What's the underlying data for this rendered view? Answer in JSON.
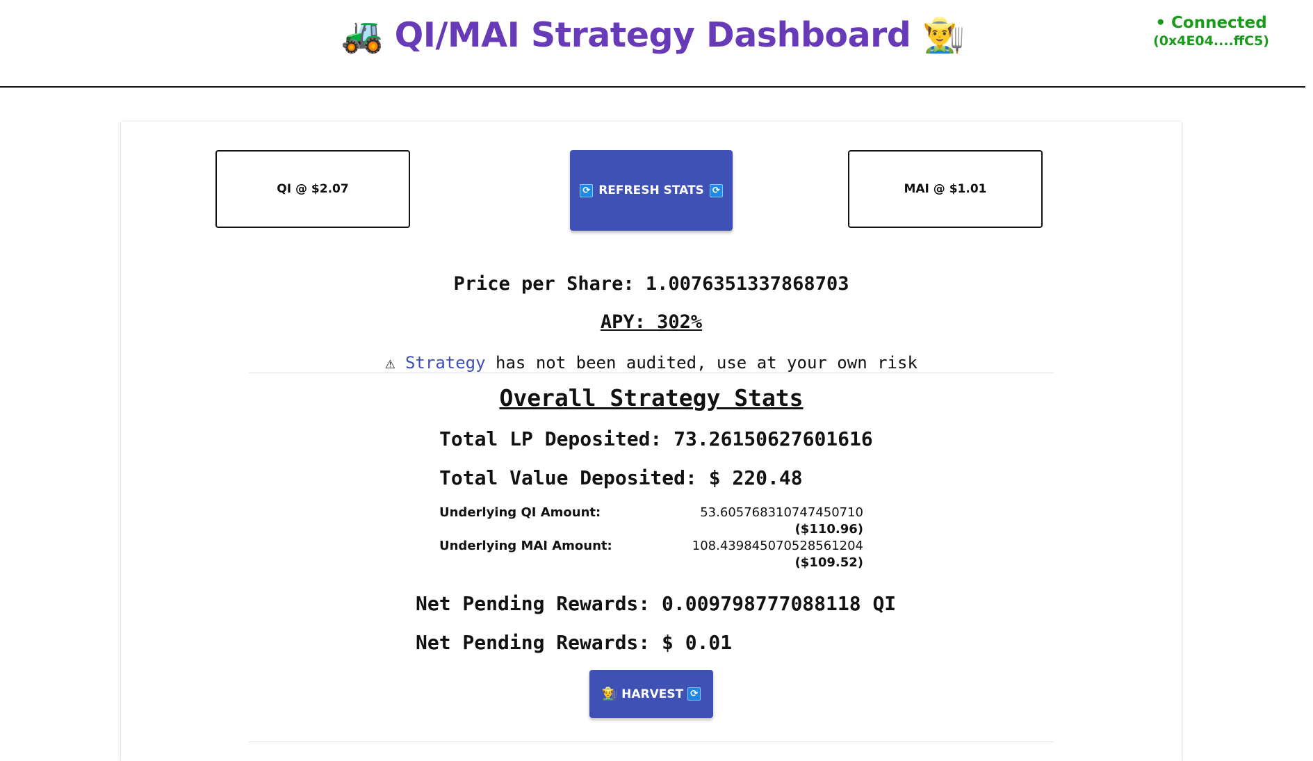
{
  "header": {
    "title": "QI/MAI Strategy Dashboard",
    "icon_left": "🚜",
    "icon_right": "👨‍🌾",
    "connection_status": "• Connected",
    "wallet_address": "(0x4E04....ffC5)"
  },
  "prices": {
    "qi_label": "QI @ $2.07",
    "mai_label": "MAI @ $1.01"
  },
  "refresh_button": {
    "label": "REFRESH STATS",
    "icon": "sync-icon"
  },
  "price_per_share": "Price per Share: 1.0076351337868703",
  "apy": "APY: 302%",
  "warning": {
    "icon": "⚠",
    "link_text": "Strategy",
    "text": " has not been audited, use at your own risk"
  },
  "overall": {
    "heading": "Overall Strategy Stats",
    "total_lp": "Total LP Deposited: 73.26150627601616",
    "total_value": "Total Value Deposited: $ 220.48",
    "qi": {
      "label": "Underlying QI Amount:",
      "amount": "53.605768310747450710",
      "usd": "($110.96)"
    },
    "mai": {
      "label": "Underlying MAI Amount:",
      "amount": "108.439845070528561204",
      "usd": "($109.52)"
    },
    "net_pending_qi": "Net Pending Rewards: 0.009798777088118 QI",
    "net_pending_usd": "Net Pending Rewards: $ 0.01"
  },
  "harvest_button": {
    "label": "HARVEST",
    "icon_left": "👨‍🌾",
    "icon_right": "sync-icon"
  },
  "colors": {
    "accent": "#673ab7",
    "button": "#3f51b5",
    "connected": "#1a9a1a"
  }
}
